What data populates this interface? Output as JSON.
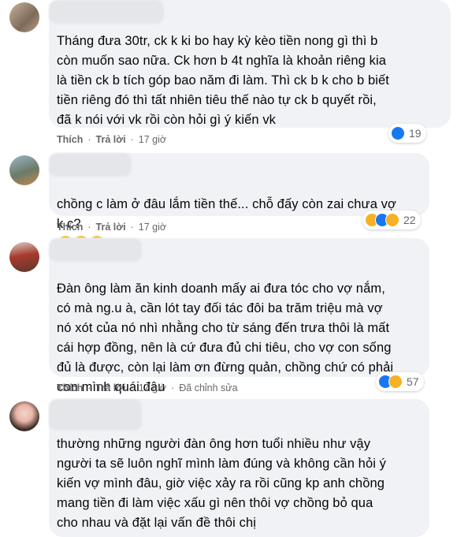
{
  "comments": [
    {
      "text": "Tháng đưa 30tr, ck k ki bo hay kỳ kèo tiền nong gì thì b\ncòn muốn sao nữa. Ck hơn b 4t nghĩa là khoản riêng kia\nlà tiền ck b tích góp bao năm đi làm. Thì ck b k cho b biết\ntiền riêng đó thì tất nhiên tiêu thế nào tự ck b quyết rồi,\nđã k nói với vk rồi còn hỏi gì ý kiến vk",
      "like_label": "Thích",
      "reply_label": "Trả lời",
      "time": "17 giờ",
      "reaction_count": "19",
      "reactions": [
        "like-icon"
      ]
    },
    {
      "text": "chồng c làm ở đâu lắm tiền thế... chỗ đấy còn zai chưa vợ\nk c?",
      "like_label": "Thích",
      "reply_label": "Trả lời",
      "time": "17 giờ",
      "reaction_count": "22",
      "reactions": [
        "haha-icon",
        "like-icon",
        "wow-icon"
      ]
    },
    {
      "text": "Đàn ông làm ăn kinh doanh mấy ai đưa tóc cho vợ nắm,\ncó mà ng.u à, cần lót tay đối tác đôi ba trăm triệu mà vợ\nnó xót của nó nhì nhằng cho từ sáng đến trưa thôi là mất\ncái hợp đồng, nên là cứ đưa đủ chi tiêu, cho vợ con sống\nđủ là được, còn lại làm ơn đừng quản, chồng chứ có phải\ncon mình quái đâu",
      "like_label": "Thích",
      "reply_label": "Trả lời",
      "time": "17 giờ",
      "edited": "Đã chỉnh sửa",
      "reaction_count": "57",
      "reactions": [
        "like-icon",
        "haha-icon"
      ]
    },
    {
      "text": "thường những người đàn ông hơn tuổi nhiều như vậy\nngười ta sẽ luôn nghĩ mình làm đúng và không cần hỏi ý\nkiến vợ mình đâu, giờ việc xảy ra rồi cũng kp anh chồng\nmang tiền đi làm việc xấu gì nên thôi vợ chồng bỏ qua\ncho nhau và đặt lại vấn đề thôi chị"
    }
  ],
  "colors": {
    "like": "#1877f2",
    "haha": "#f7b125",
    "bubble": "#f0f2f5",
    "meta": "#65676b"
  }
}
